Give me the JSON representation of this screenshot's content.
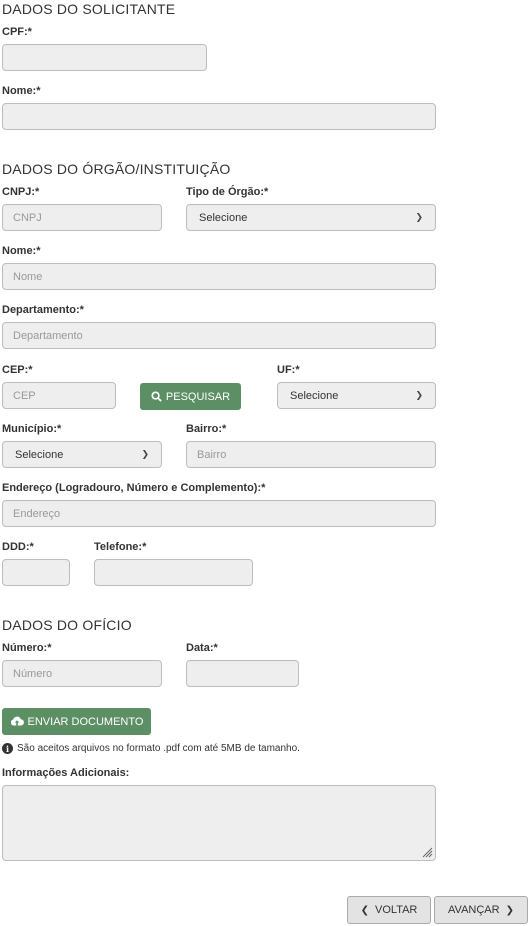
{
  "solicitante": {
    "title": "DADOS DO SOLICITANTE",
    "cpf_label": "CPF:*",
    "nome_label": "Nome:*"
  },
  "orgao": {
    "title": "DADOS DO ÓRGÃO/INSTITUIÇÃO",
    "cnpj_label": "CNPJ:*",
    "cnpj_placeholder": "CNPJ",
    "tipo_label": "Tipo de Órgão:*",
    "tipo_value": "Selecione",
    "nome_label": "Nome:*",
    "nome_placeholder": "Nome",
    "departamento_label": "Departamento:*",
    "departamento_placeholder": "Departamento",
    "cep_label": "CEP:*",
    "cep_placeholder": "CEP",
    "pesquisar_label": "PESQUISAR",
    "uf_label": "UF:*",
    "uf_value": "Selecione",
    "municipio_label": "Município:*",
    "municipio_value": "Selecione",
    "bairro_label": "Bairro:*",
    "bairro_placeholder": "Bairro",
    "endereco_label": "Endereço (Logradouro, Número e Complemento):*",
    "endereco_placeholder": "Endereço",
    "ddd_label": "DDD:*",
    "telefone_label": "Telefone:*"
  },
  "oficio": {
    "title": "DADOS DO OFÍCIO",
    "numero_label": "Número:*",
    "numero_placeholder": "Número",
    "data_label": "Data:*",
    "enviar_label": "ENVIAR DOCUMENTO",
    "info_text": "São aceitos arquivos no formato .pdf com até 5MB de tamanho.",
    "info_adicionais_label": "Informações Adicionais:"
  },
  "nav": {
    "voltar_label": "VOLTAR",
    "avancar_label": "AVANÇAR"
  },
  "colors": {
    "green_button": "#5c8f64",
    "field_bg": "#eeeeee"
  }
}
